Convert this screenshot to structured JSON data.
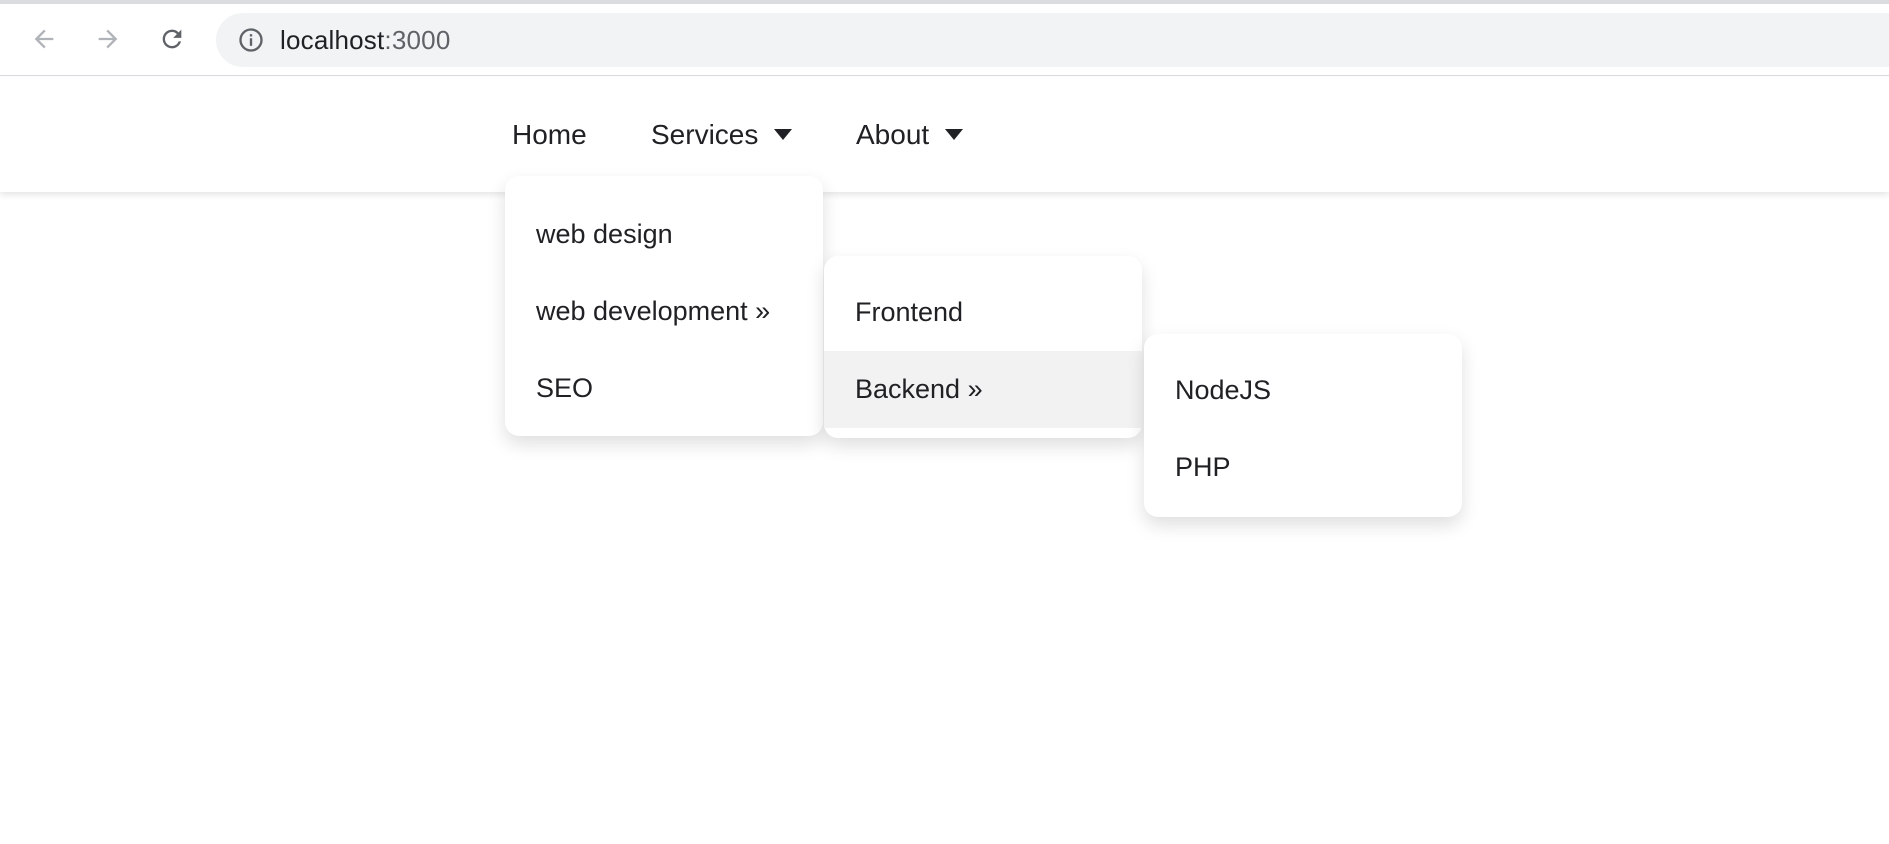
{
  "browser": {
    "url_host": "localhost",
    "url_port": ":3000",
    "icons": [
      "back-arrow-icon",
      "forward-arrow-icon",
      "reload-icon",
      "info-icon"
    ]
  },
  "nav": {
    "items": [
      {
        "label": "Home",
        "has_dropdown": false
      },
      {
        "label": "Services",
        "has_dropdown": true
      },
      {
        "label": "About",
        "has_dropdown": true
      }
    ]
  },
  "services_menu": {
    "items": [
      {
        "label": "web design"
      },
      {
        "label": "web development »"
      },
      {
        "label": "SEO"
      }
    ]
  },
  "webdev_menu": {
    "items": [
      {
        "label": "Frontend"
      },
      {
        "label": "Backend »",
        "highlighted": true
      }
    ]
  },
  "backend_menu": {
    "items": [
      {
        "label": "NodeJS"
      },
      {
        "label": "PHP"
      }
    ]
  },
  "colors": {
    "text": "#202124",
    "omnibox_bg": "#f1f3f4",
    "menu_bg": "#ffffff",
    "highlight_bg": "#f2f2f2"
  }
}
